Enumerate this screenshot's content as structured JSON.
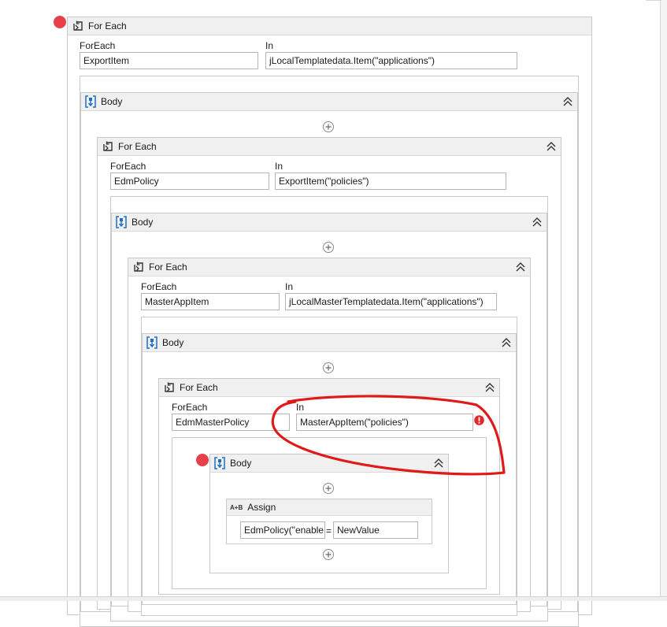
{
  "workflow": {
    "foreach1": {
      "title": "For Each",
      "foreach_label": "ForEach",
      "in_label": "In",
      "item": "ExportItem",
      "in_value": "jLocalTemplatedata.Item(\"applications\")",
      "body_title": "Body"
    },
    "foreach2": {
      "title": "For Each",
      "foreach_label": "ForEach",
      "in_label": "In",
      "item": "EdmPolicy",
      "in_value": "ExportItem(\"policies\")",
      "body_title": "Body"
    },
    "foreach3": {
      "title": "For Each",
      "foreach_label": "ForEach",
      "in_label": "In",
      "item": "MasterAppItem",
      "in_value": "jLocalMasterTemplatedata.Item(\"applications\")",
      "body_title": "Body"
    },
    "foreach4": {
      "title": "For Each",
      "foreach_label": "ForEach",
      "in_label": "In",
      "item": "EdmMasterPolicy",
      "in_value": "MasterAppItem(\"policies\")",
      "body_title": "Body",
      "error": true
    },
    "assign": {
      "icon_text": "A+B",
      "title": "Assign",
      "to_value": "EdmPolicy(\"enable",
      "operator": "=",
      "value": "NewValue"
    }
  },
  "colors": {
    "breakpoint": "#e8404a",
    "annotation": "#e01919",
    "error": "#e0282e",
    "icon_blue": "#1e6fc4"
  },
  "icons": {
    "foreach": "foreach-icon",
    "body": "sequence-body-icon",
    "collapse": "collapse-chevrons-icon",
    "add": "add-activity-icon",
    "breakpoint": "breakpoint-icon",
    "error": "error-icon"
  }
}
